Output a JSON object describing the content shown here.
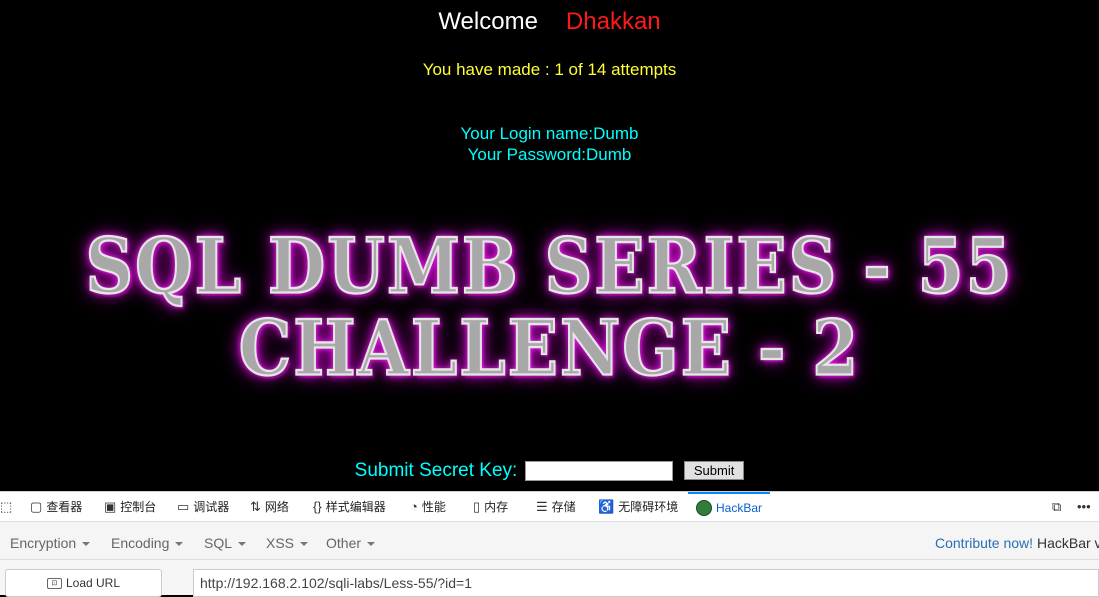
{
  "page": {
    "welcome": "Welcome",
    "user": "Dhakkan",
    "attempts": "You have made : 1 of 14 attempts",
    "login_name": "Your Login name:Dumb",
    "password": "Your Password:Dumb",
    "title_line1": "SQL DUMB SERIES - 55",
    "title_line2": "CHALLENGE - 2",
    "secret_label": "Submit Secret Key:",
    "secret_value": "",
    "submit_label": "Submit"
  },
  "devtools": {
    "tabs": [
      {
        "label": "查看器",
        "icon": "inspector-icon"
      },
      {
        "label": "控制台",
        "icon": "console-icon"
      },
      {
        "label": "调试器",
        "icon": "debugger-icon"
      },
      {
        "label": "网络",
        "icon": "network-icon"
      },
      {
        "label": "样式编辑器",
        "icon": "style-editor-icon"
      },
      {
        "label": "性能",
        "icon": "performance-icon"
      },
      {
        "label": "内存",
        "icon": "memory-icon"
      },
      {
        "label": "存储",
        "icon": "storage-icon"
      },
      {
        "label": "无障碍环境",
        "icon": "accessibility-icon"
      },
      {
        "label": "HackBar",
        "icon": "hackbar-icon"
      }
    ],
    "active_tab": "HackBar"
  },
  "hackbar": {
    "menus": [
      "Encryption",
      "Encoding",
      "SQL",
      "XSS",
      "Other"
    ],
    "contribute_link": "Contribute now!",
    "contribute_suffix": "HackBar v",
    "load_url_label": "Load URL",
    "url": "http://192.168.2.102/sqli-labs/Less-55/?id=1"
  },
  "colors": {
    "welcome": "#ffffff",
    "user": "#ff1a1a",
    "attempts": "#ffff33",
    "info": "#00ffff",
    "title_glow": "#cc00cc",
    "active_tab": "#0a84ff"
  }
}
